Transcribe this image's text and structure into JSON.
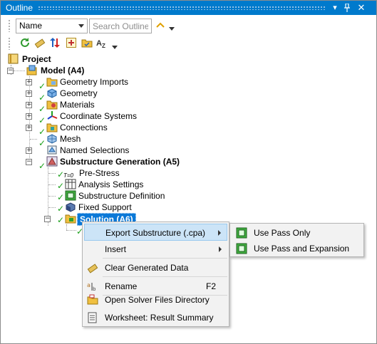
{
  "panel": {
    "title": "Outline",
    "title_buttons": [
      "dropdown-icon",
      "pin-icon",
      "close-icon"
    ]
  },
  "toolbar": {
    "name_select_value": "Name",
    "search_placeholder": "Search Outline",
    "icons": [
      "refresh-icon",
      "clear-icon",
      "sort-icon",
      "expand-all-icon",
      "collapse-icon",
      "sort-alpha-icon"
    ]
  },
  "tree": {
    "project": "Project",
    "model": "Model (A4)",
    "model_children": [
      "Geometry Imports",
      "Geometry",
      "Materials",
      "Coordinate Systems",
      "Connections",
      "Mesh",
      "Named Selections",
      "Substructure Generation (A5)"
    ],
    "analysis_children": [
      "Pre-Stress",
      "Analysis Settings",
      "Substructure Definition",
      "Fixed Support",
      "Solution (A6)"
    ],
    "prestress_badge": "T=0"
  },
  "context_menu": {
    "items": [
      {
        "label": "Export Substructure (.cpa)",
        "icon": "export-icon",
        "submenu": true
      },
      {
        "label": "Insert",
        "icon": "",
        "submenu": true
      },
      {
        "label": "Clear Generated Data",
        "icon": "eraser-icon",
        "submenu": false
      },
      {
        "label": "Rename",
        "icon": "rename-icon",
        "shortcut": "F2",
        "submenu": false
      },
      {
        "label": "Open Solver Files Directory",
        "icon": "folder-open-icon",
        "submenu": false
      },
      {
        "label": "Worksheet: Result Summary",
        "icon": "worksheet-icon",
        "submenu": false
      }
    ]
  },
  "submenu": {
    "items": [
      {
        "label": "Use Pass Only",
        "icon": "use-pass-icon"
      },
      {
        "label": "Use Pass and Expansion",
        "icon": "use-pass-expansion-icon"
      }
    ]
  },
  "colors": {
    "titlebar": "#007acc",
    "selection": "#0a78d7",
    "check": "#1aa01a",
    "menu_bg": "#f2f2f2",
    "menu_highlight": "#cce4f7"
  }
}
